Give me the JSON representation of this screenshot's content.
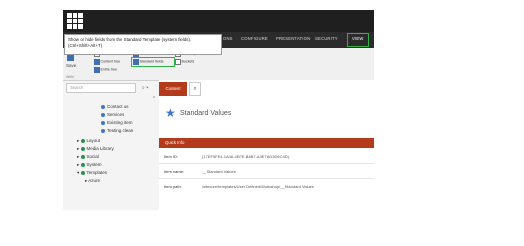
{
  "tooltip": {
    "line1": "Show or hide fields from the Standard Template (system fields).",
    "line2": "(Ctrl+Shift+Alt+T)"
  },
  "ribbon_tabs": [
    "ONS",
    "CONFIGURE",
    "PRESENTATION",
    "SECURITY",
    "VIEW"
  ],
  "ribbon": {
    "save_label": "Save",
    "checkboxes": [
      {
        "label": "Editor",
        "checked": false
      },
      {
        "label": "Content tree",
        "checked": true
      },
      {
        "label": "Raw values",
        "checked": false
      },
      {
        "label": "Standard fields",
        "checked": true
      },
      {
        "label": "Entire tree",
        "checked": true
      },
      {
        "label": "Buckets",
        "checked": false
      },
      {
        "label": "Auto Expand",
        "checked": false
      }
    ],
    "group_label": "Write"
  },
  "search": {
    "placeholder": "Search"
  },
  "tree": {
    "items": [
      {
        "label": "Contact us",
        "color": "#3f77c6"
      },
      {
        "label": "Services",
        "color": "#3f77c6"
      },
      {
        "label": "Existing item",
        "color": "#3f77c6"
      },
      {
        "label": "Testing clean",
        "color": "#3f77c6"
      },
      {
        "label": "Layout",
        "color": "#2d8f4e"
      },
      {
        "label": "Media Library",
        "color": "#2d8f4e"
      },
      {
        "label": "Social",
        "color": "#2d8f4e"
      },
      {
        "label": "System",
        "color": "#2d8f4e"
      },
      {
        "label": "Templates",
        "color": "#2d8f4e"
      },
      {
        "label": "Azure",
        "color": "#555555"
      }
    ]
  },
  "content": {
    "tab_label": "Content",
    "item_title": "Standard Values",
    "quick_info_title": "Quick Info",
    "rows": [
      {
        "label": "Item ID:",
        "value": "{17EF9FE4-1A46-4EFE-B8B7-A3E7AD3D6C4D}"
      },
      {
        "label": "Item name:",
        "value": "__Standard Values"
      },
      {
        "label": "Item path:",
        "value": "/sitecore/templates/User Defined/Workshop/__Standard Values"
      }
    ]
  },
  "colors": {
    "accent": "#b33b1b",
    "highlight": "#2db24a",
    "topbar": "#1f1f1f"
  }
}
